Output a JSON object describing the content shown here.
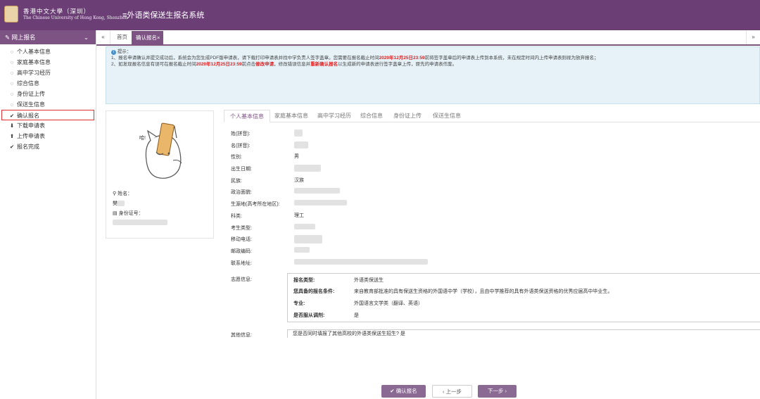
{
  "header": {
    "univ_cn": "香港中文大學（深圳）",
    "univ_en": "The Chinese University of Hong Kong, Shenzhen",
    "menu_icon": "≡",
    "system_title": "外语类保送生报名系统"
  },
  "sidebar": {
    "title": "网上报名",
    "items": [
      {
        "label": "个人基本信息",
        "icon": "◌"
      },
      {
        "label": "家庭基本信息",
        "icon": "◌"
      },
      {
        "label": "高中学习经历",
        "icon": "◌"
      },
      {
        "label": "综合信息",
        "icon": "◌"
      },
      {
        "label": "身份证上传",
        "icon": "◌"
      },
      {
        "label": "保送生信息",
        "icon": "◌"
      },
      {
        "label": "确认报名",
        "icon": "✔"
      },
      {
        "label": "下载申请表",
        "icon": "⬇"
      },
      {
        "label": "上传申请表",
        "icon": "⬆"
      },
      {
        "label": "报名完成",
        "icon": "✔"
      }
    ]
  },
  "tabbar": {
    "home": "首页",
    "active_tab": "确认报名",
    "close_icon": "×",
    "left_nav": "«",
    "right_nav": "»"
  },
  "notice": {
    "title": "提示：",
    "line1_a": "1、报名申请确认并提交成功后，系统会为您生成PDF版申请表，请下载打印申请表并找中学负责人签字盖章。您需要在报名截止时间",
    "line1_deadline": "2020年12月25日23:59",
    "line1_b": "前将签字盖章后的申请表上传到本系统，未在规定时间内上传申请表则视为放弃报名；",
    "line2_a": "2、如发现报名信息有误可在报名截止时间",
    "line2_deadline": "2020年12月25日23:59",
    "line2_b": "前点击",
    "line2_modify": "修改申请",
    "line2_c": "，修改错误信息并",
    "line2_reconfirm": "重新确认报名",
    "line2_d": "以生成新的申请表进行签字盖章上传，原先的申请表作废。"
  },
  "profile_card": {
    "name_label": "姓名：",
    "name_value": "樊",
    "id_label": "身份证号："
  },
  "tabs": [
    "个人基本信息",
    "家庭基本信息",
    "高中学习经历",
    "综合信息",
    "身份证上传",
    "保送生信息"
  ],
  "fields": [
    {
      "label": "姓(拼音):",
      "value": ""
    },
    {
      "label": "名(拼音):",
      "value": ""
    },
    {
      "label": "性别:",
      "value": "男"
    },
    {
      "label": "出生日期:",
      "value": ""
    },
    {
      "label": "民族:",
      "value": "汉族"
    },
    {
      "label": "政治面貌:",
      "value": ""
    },
    {
      "label": "生源地(高考所在地区):",
      "value": ""
    },
    {
      "label": "科类:",
      "value": "理工"
    },
    {
      "label": "考生类型:",
      "value": ""
    },
    {
      "label": "移动电话:",
      "value": ""
    },
    {
      "label": "邮政编码:",
      "value": ""
    },
    {
      "label": "联系地址:",
      "value": ""
    }
  ],
  "volunteer": {
    "label": "志愿信息:",
    "rows": [
      {
        "k": "报名类型:",
        "v": "外语类保送生"
      },
      {
        "k": "您具备的报名条件:",
        "v": "来自教育部批准的具有保送生资格的外国语中学（学校），且由中学推荐的具有外语类保送资格的优秀应届高中毕业生。"
      },
      {
        "k": "专业:",
        "v": "外国语言文学类（翻译、英语）"
      },
      {
        "k": "是否服从调剂:",
        "v": "是"
      }
    ]
  },
  "other": {
    "label": "其他信息:",
    "question": "您是否同时填报了其他高校的外语类保送生招生?",
    "answer": "是"
  },
  "buttons": {
    "confirm": "确认报名",
    "prev": "上一步",
    "next": "下一步"
  },
  "colors": {
    "header_bg": "#6b3f76",
    "accent": "#7d5384",
    "button": "#8a6a93",
    "notice_bg": "#e6f2f8",
    "deadline_red": "#e02020",
    "active_outline": "#e03030"
  }
}
